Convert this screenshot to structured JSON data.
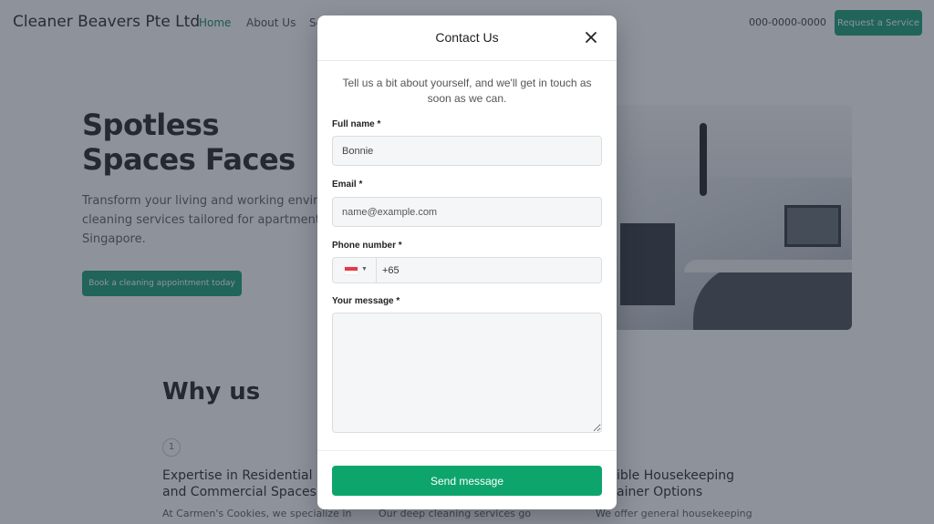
{
  "nav": {
    "brand": "Cleaner Beavers Pte Ltd",
    "links": [
      "Home",
      "About Us",
      "Se"
    ],
    "phone": "000-0000-0000",
    "cta_label": "Request a Service"
  },
  "hero": {
    "title": "Spotless Spaces Faces",
    "subtitle": "Transform your living and working enviro cleaning services tailored for apartments Singapore.",
    "button_label": "Book a cleaning appointment today"
  },
  "why": {
    "title": "Why us",
    "number": "1",
    "features": [
      {
        "title": "Expertise in Residential and Commercial Spaces",
        "text": "At Carmen's Cookies, we specialize in"
      },
      {
        "title": "",
        "text": "Our deep cleaning services go"
      },
      {
        "title": "ible Housekeeping ainer Options",
        "text": "We offer general housekeeping"
      }
    ]
  },
  "modal": {
    "title": "Contact Us",
    "intro": "Tell us a bit about yourself, and we'll get in touch as soon as we can.",
    "fields": {
      "full_name_label": "Full name *",
      "full_name_value": "Bonnie",
      "email_label": "Email *",
      "email_placeholder": "name@example.com",
      "phone_label": "Phone number *",
      "phone_value": "+65",
      "message_label": "Your message *"
    },
    "submit_label": "Send message"
  },
  "icons": {
    "close": "close-icon",
    "flag": "singapore-flag-icon",
    "caret": "chevron-down-icon"
  },
  "colors": {
    "accent": "#0ea56d",
    "nav_active": "#1a8c6e",
    "overlay": "#1e2638"
  }
}
